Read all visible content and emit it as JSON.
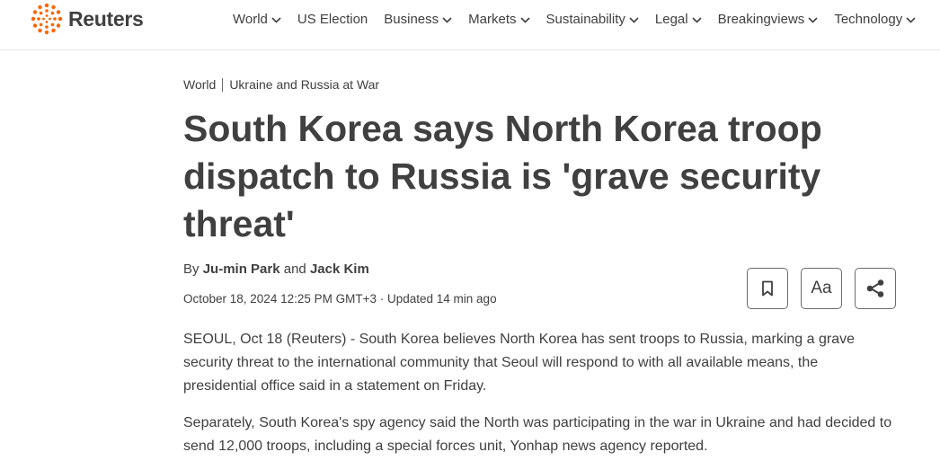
{
  "brand": {
    "name": "Reuters",
    "accent": "#fa6400"
  },
  "nav": {
    "items": [
      {
        "label": "World",
        "dropdown": true
      },
      {
        "label": "US Election",
        "dropdown": false
      },
      {
        "label": "Business",
        "dropdown": true
      },
      {
        "label": "Markets",
        "dropdown": true
      },
      {
        "label": "Sustainability",
        "dropdown": true
      },
      {
        "label": "Legal",
        "dropdown": true
      },
      {
        "label": "Breakingviews",
        "dropdown": true
      },
      {
        "label": "Technology",
        "dropdown": true
      }
    ]
  },
  "breadcrumb": {
    "section": "World",
    "topic": "Ukraine and Russia at War"
  },
  "article": {
    "headline": "South Korea says North Korea troop dispatch to Russia is 'grave security threat'",
    "byline": {
      "prefix": "By",
      "author1": "Ju-min Park",
      "joiner": "and",
      "author2": "Jack Kim"
    },
    "dateline": "October 18, 2024 12:25 PM GMT+3 · Updated 14 min ago",
    "tools": {
      "bookmark_icon": "bookmark-icon",
      "text_size_label": "Aa",
      "share_icon": "share-icon"
    },
    "paragraphs": [
      "SEOUL, Oct 18 (Reuters) - South Korea believes North Korea has sent troops to Russia, marking a grave security threat to the international community that Seoul will respond to with all available means, the presidential office said in a statement on Friday.",
      "Separately, South Korea's spy agency said the North was participating in the war in Ukraine and had decided to send 12,000 troops, including a special forces unit, Yonhap news agency reported."
    ]
  }
}
